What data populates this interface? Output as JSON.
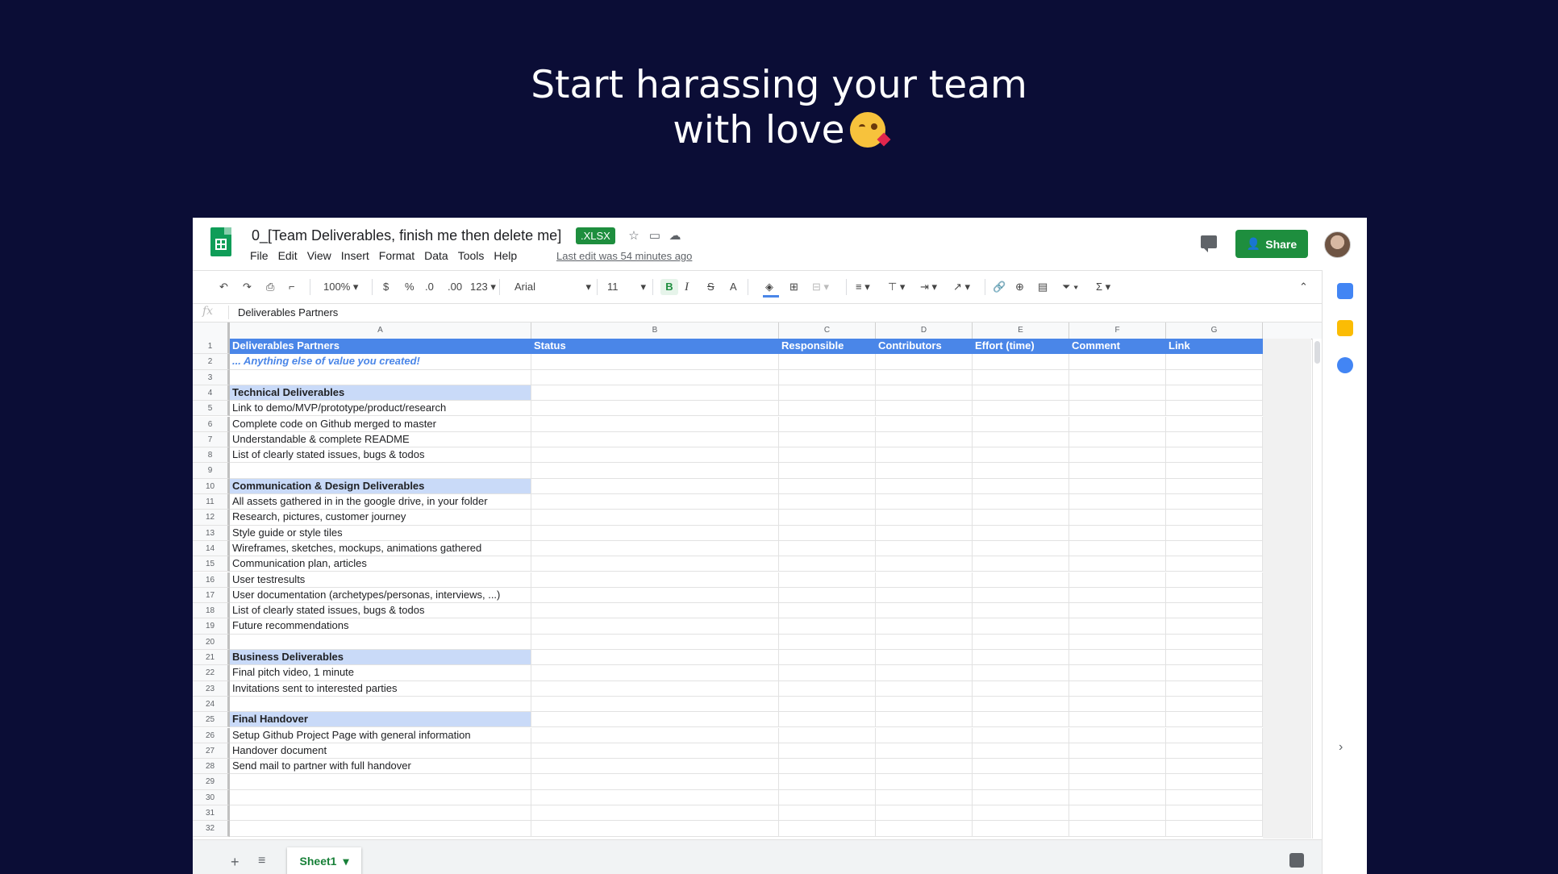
{
  "headline": {
    "line1": "Start harassing your team",
    "line2": "with love"
  },
  "doc": {
    "title": "0_[Team Deliverables, finish me then delete me]",
    "badge": ".XLSX",
    "menu": [
      "File",
      "Edit",
      "View",
      "Insert",
      "Format",
      "Data",
      "Tools",
      "Help"
    ],
    "last_edit": "Last edit was 54 minutes ago",
    "share_label": "Share"
  },
  "toolbar": {
    "zoom": "100%",
    "currency": "$",
    "percent": "%",
    "dec_decrease": ".0",
    "dec_increase": ".00",
    "more_formats": "123",
    "font": "Arial",
    "font_size": "11",
    "bold": "B",
    "italic": "I",
    "strike": "S",
    "text_color": "A",
    "function": "Σ"
  },
  "formula_bar": {
    "fx": "fx",
    "value": "Deliverables Partners"
  },
  "columns": [
    "A",
    "B",
    "C",
    "D",
    "E",
    "F",
    "G"
  ],
  "rows": [
    {
      "n": "1",
      "type": "header",
      "cells": [
        "Deliverables Partners",
        "Status",
        "Responsible",
        "Contributors",
        "Effort (time)",
        "Comment",
        "Link"
      ]
    },
    {
      "n": "2",
      "type": "note",
      "cells": [
        "... Anything else of value you created!"
      ]
    },
    {
      "n": "3",
      "type": "plain",
      "cells": [
        ""
      ]
    },
    {
      "n": "4",
      "type": "section",
      "cells": [
        "Technical Deliverables"
      ]
    },
    {
      "n": "5",
      "type": "plain",
      "cells": [
        "Link to demo/MVP/prototype/product/research"
      ]
    },
    {
      "n": "6",
      "type": "plain",
      "cells": [
        "Complete code on Github merged to master"
      ]
    },
    {
      "n": "7",
      "type": "plain",
      "cells": [
        "Understandable & complete README"
      ]
    },
    {
      "n": "8",
      "type": "plain",
      "cells": [
        "List of clearly stated issues, bugs & todos"
      ]
    },
    {
      "n": "9",
      "type": "plain",
      "cells": [
        ""
      ]
    },
    {
      "n": "10",
      "type": "section",
      "cells": [
        "Communication & Design Deliverables"
      ]
    },
    {
      "n": "11",
      "type": "plain",
      "cells": [
        "All assets gathered in in the google drive, in your folder"
      ]
    },
    {
      "n": "12",
      "type": "plain",
      "cells": [
        "Research, pictures, customer journey"
      ]
    },
    {
      "n": "13",
      "type": "plain",
      "cells": [
        "Style guide or style tiles"
      ]
    },
    {
      "n": "14",
      "type": "plain",
      "cells": [
        "Wireframes, sketches, mockups, animations gathered"
      ]
    },
    {
      "n": "15",
      "type": "plain",
      "cells": [
        "Communication plan, articles"
      ]
    },
    {
      "n": "16",
      "type": "plain",
      "cells": [
        "User testresults"
      ]
    },
    {
      "n": "17",
      "type": "plain",
      "cells": [
        "User documentation (archetypes/personas, interviews, ...)"
      ]
    },
    {
      "n": "18",
      "type": "plain",
      "cells": [
        "List of clearly stated issues, bugs & todos"
      ]
    },
    {
      "n": "19",
      "type": "plain",
      "cells": [
        "Future recommendations"
      ]
    },
    {
      "n": "20",
      "type": "plain",
      "cells": [
        ""
      ]
    },
    {
      "n": "21",
      "type": "section",
      "cells": [
        "Business Deliverables"
      ]
    },
    {
      "n": "22",
      "type": "plain",
      "cells": [
        "Final pitch video, 1 minute"
      ]
    },
    {
      "n": "23",
      "type": "plain",
      "cells": [
        "Invitations sent to interested parties"
      ]
    },
    {
      "n": "24",
      "type": "plain",
      "cells": [
        ""
      ]
    },
    {
      "n": "25",
      "type": "section",
      "cells": [
        "Final Handover"
      ]
    },
    {
      "n": "26",
      "type": "plain",
      "cells": [
        "Setup Github Project Page with general information"
      ]
    },
    {
      "n": "27",
      "type": "plain",
      "cells": [
        "Handover document"
      ]
    },
    {
      "n": "28",
      "type": "plain",
      "cells": [
        "Send mail to partner with full handover"
      ]
    },
    {
      "n": "29",
      "type": "plain",
      "cells": [
        ""
      ]
    },
    {
      "n": "30",
      "type": "plain",
      "cells": [
        ""
      ]
    },
    {
      "n": "31",
      "type": "plain",
      "cells": [
        ""
      ]
    },
    {
      "n": "32",
      "type": "plain",
      "cells": [
        ""
      ]
    }
  ],
  "sheet": {
    "name": "Sheet1"
  },
  "colors": {
    "header_blue": "#4a86e8",
    "section_blue": "#c9daf8",
    "share_green": "#1e8e3e",
    "background": "#0b0d36"
  }
}
